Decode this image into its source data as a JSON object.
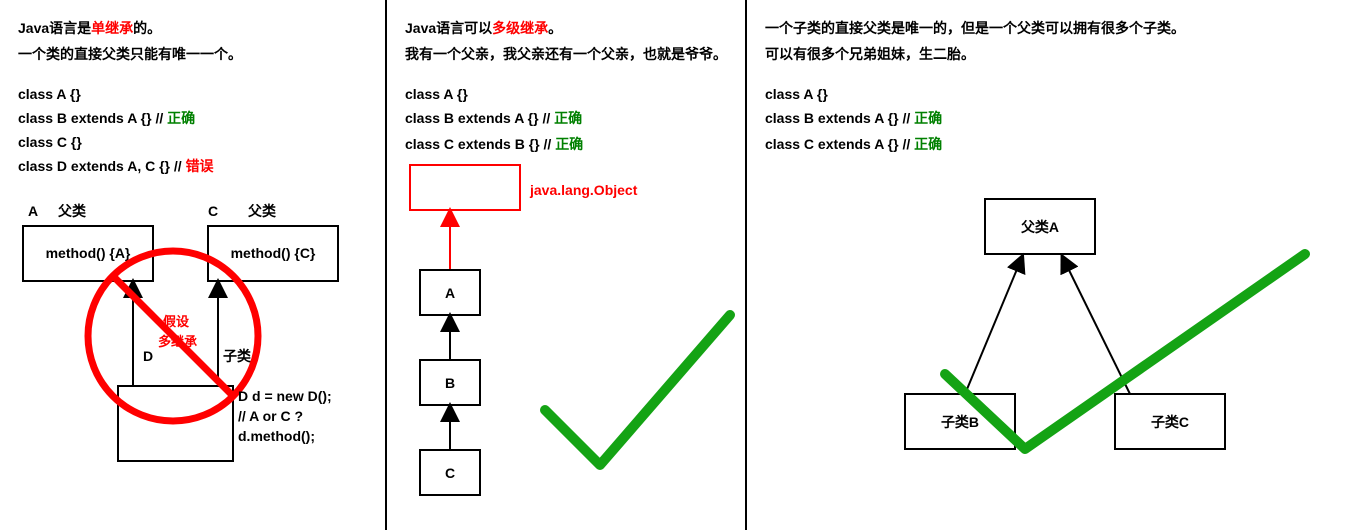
{
  "panel1": {
    "t1a": "Java语言是",
    "t1b": "单继承",
    "t1c": "的。",
    "t2": "一个类的直接父类只能有唯一一个。",
    "code1": "class A {}",
    "code2a": "class B extends A {} // ",
    "code2b": "正确",
    "code3": "class C {}",
    "code4a": "class D extends A, C {} // ",
    "code4b": "错误",
    "labA": "A",
    "labParent": "父类",
    "labC": "C",
    "boxA": "method() {A}",
    "boxC": "method() {C}",
    "labD": "D",
    "labChild": "子类",
    "note1": "假设",
    "note2": "多继承",
    "use1": "D d = new D();",
    "use2": "// A or C ?",
    "use3": "d.method();"
  },
  "panel2": {
    "t1a": "Java语言可以",
    "t1b": "多级继承",
    "t1c": "。",
    "t2": "我有一个父亲，我父亲还有一个父亲，也就是爷爷。",
    "code1": "class A {}",
    "code2a": "class B extends A {} // ",
    "code2b": "正确",
    "code3a": "class C extends B {} // ",
    "code3b": "正确",
    "obj": "java.lang.Object",
    "boxA": "A",
    "boxB": "B",
    "boxC": "C"
  },
  "panel3": {
    "t1": "一个子类的直接父类是唯一的，但是一个父类可以拥有很多个子类。",
    "t2": "可以有很多个兄弟姐妹，生二胎。",
    "code1": "class A {}",
    "code2a": "class B extends A {} // ",
    "code2b": "正确",
    "code3a": "class C extends A {} // ",
    "code3b": "正确",
    "boxA": "父类A",
    "boxB": "子类B",
    "boxC": "子类C"
  }
}
